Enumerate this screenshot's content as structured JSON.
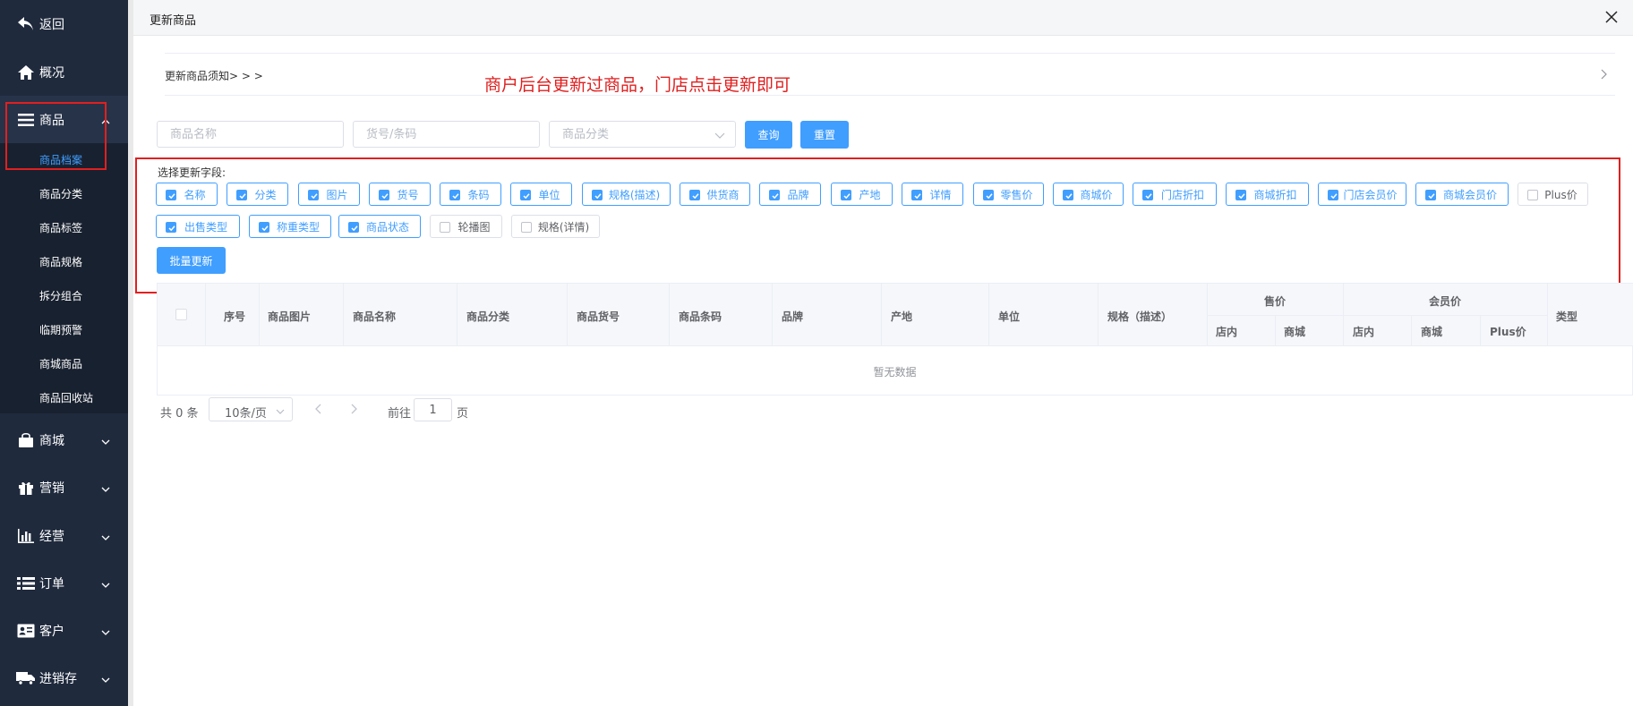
{
  "sidebar": {
    "back": "返回",
    "overview": "概况",
    "goods": "商品",
    "sub_items": [
      "商品档案",
      "商品分类",
      "商品标签",
      "商品规格",
      "拆分组合",
      "临期预警",
      "商城商品",
      "商品回收站"
    ],
    "mall": "商城",
    "marketing": "营销",
    "operations": "经营",
    "orders": "订单",
    "customers": "客户",
    "inventory": "进销存"
  },
  "modal": {
    "title": "更新商品",
    "notice": "更新商品须知> > >",
    "annotation": "商户后台更新过商品，门店点击更新即可"
  },
  "search": {
    "name_placeholder": "商品名称",
    "code_placeholder": "货号/条码",
    "category_placeholder": "商品分类",
    "query_label": "查询",
    "reset_label": "重置"
  },
  "fields": {
    "label": "选择更新字段:",
    "row1": [
      {
        "label": "名称",
        "checked": true
      },
      {
        "label": "分类",
        "checked": true
      },
      {
        "label": "图片",
        "checked": true
      },
      {
        "label": "货号",
        "checked": true
      },
      {
        "label": "条码",
        "checked": true
      },
      {
        "label": "单位",
        "checked": true
      },
      {
        "label": "规格(描述)",
        "checked": true
      },
      {
        "label": "供货商",
        "checked": true
      },
      {
        "label": "品牌",
        "checked": true
      },
      {
        "label": "产地",
        "checked": true
      },
      {
        "label": "详情",
        "checked": true
      },
      {
        "label": "零售价",
        "checked": true
      },
      {
        "label": "商城价",
        "checked": true
      },
      {
        "label": "门店折扣",
        "checked": true
      },
      {
        "label": "商城折扣",
        "checked": true
      },
      {
        "label": "门店会员价",
        "checked": true
      },
      {
        "label": "商城会员价",
        "checked": true
      },
      {
        "label": "Plus价",
        "checked": false
      }
    ],
    "row2": [
      {
        "label": "出售类型",
        "checked": true
      },
      {
        "label": "称重类型",
        "checked": true
      },
      {
        "label": "商品状态",
        "checked": true
      },
      {
        "label": "轮播图",
        "checked": false
      },
      {
        "label": "规格(详情)",
        "checked": false
      }
    ],
    "batch_update": "批量更新"
  },
  "table": {
    "headers": [
      "序号",
      "商品图片",
      "商品名称",
      "商品分类",
      "商品货号",
      "商品条码",
      "品牌",
      "产地",
      "单位",
      "规格（描述）"
    ],
    "sale_group": "售价",
    "sale_sub": [
      "店内",
      "商城"
    ],
    "member_group": "会员价",
    "member_sub": [
      "店内",
      "商城",
      "Plus价"
    ],
    "type_header": "类型",
    "empty": "暂无数据"
  },
  "pager": {
    "total": "共 0 条",
    "page_size": "10条/页",
    "goto": "前往",
    "page": "1",
    "page_suffix": "页"
  },
  "colors": {
    "sidebar_bg": "#1f2a3d",
    "accent": "#409eff",
    "annotation": "#e02020"
  }
}
